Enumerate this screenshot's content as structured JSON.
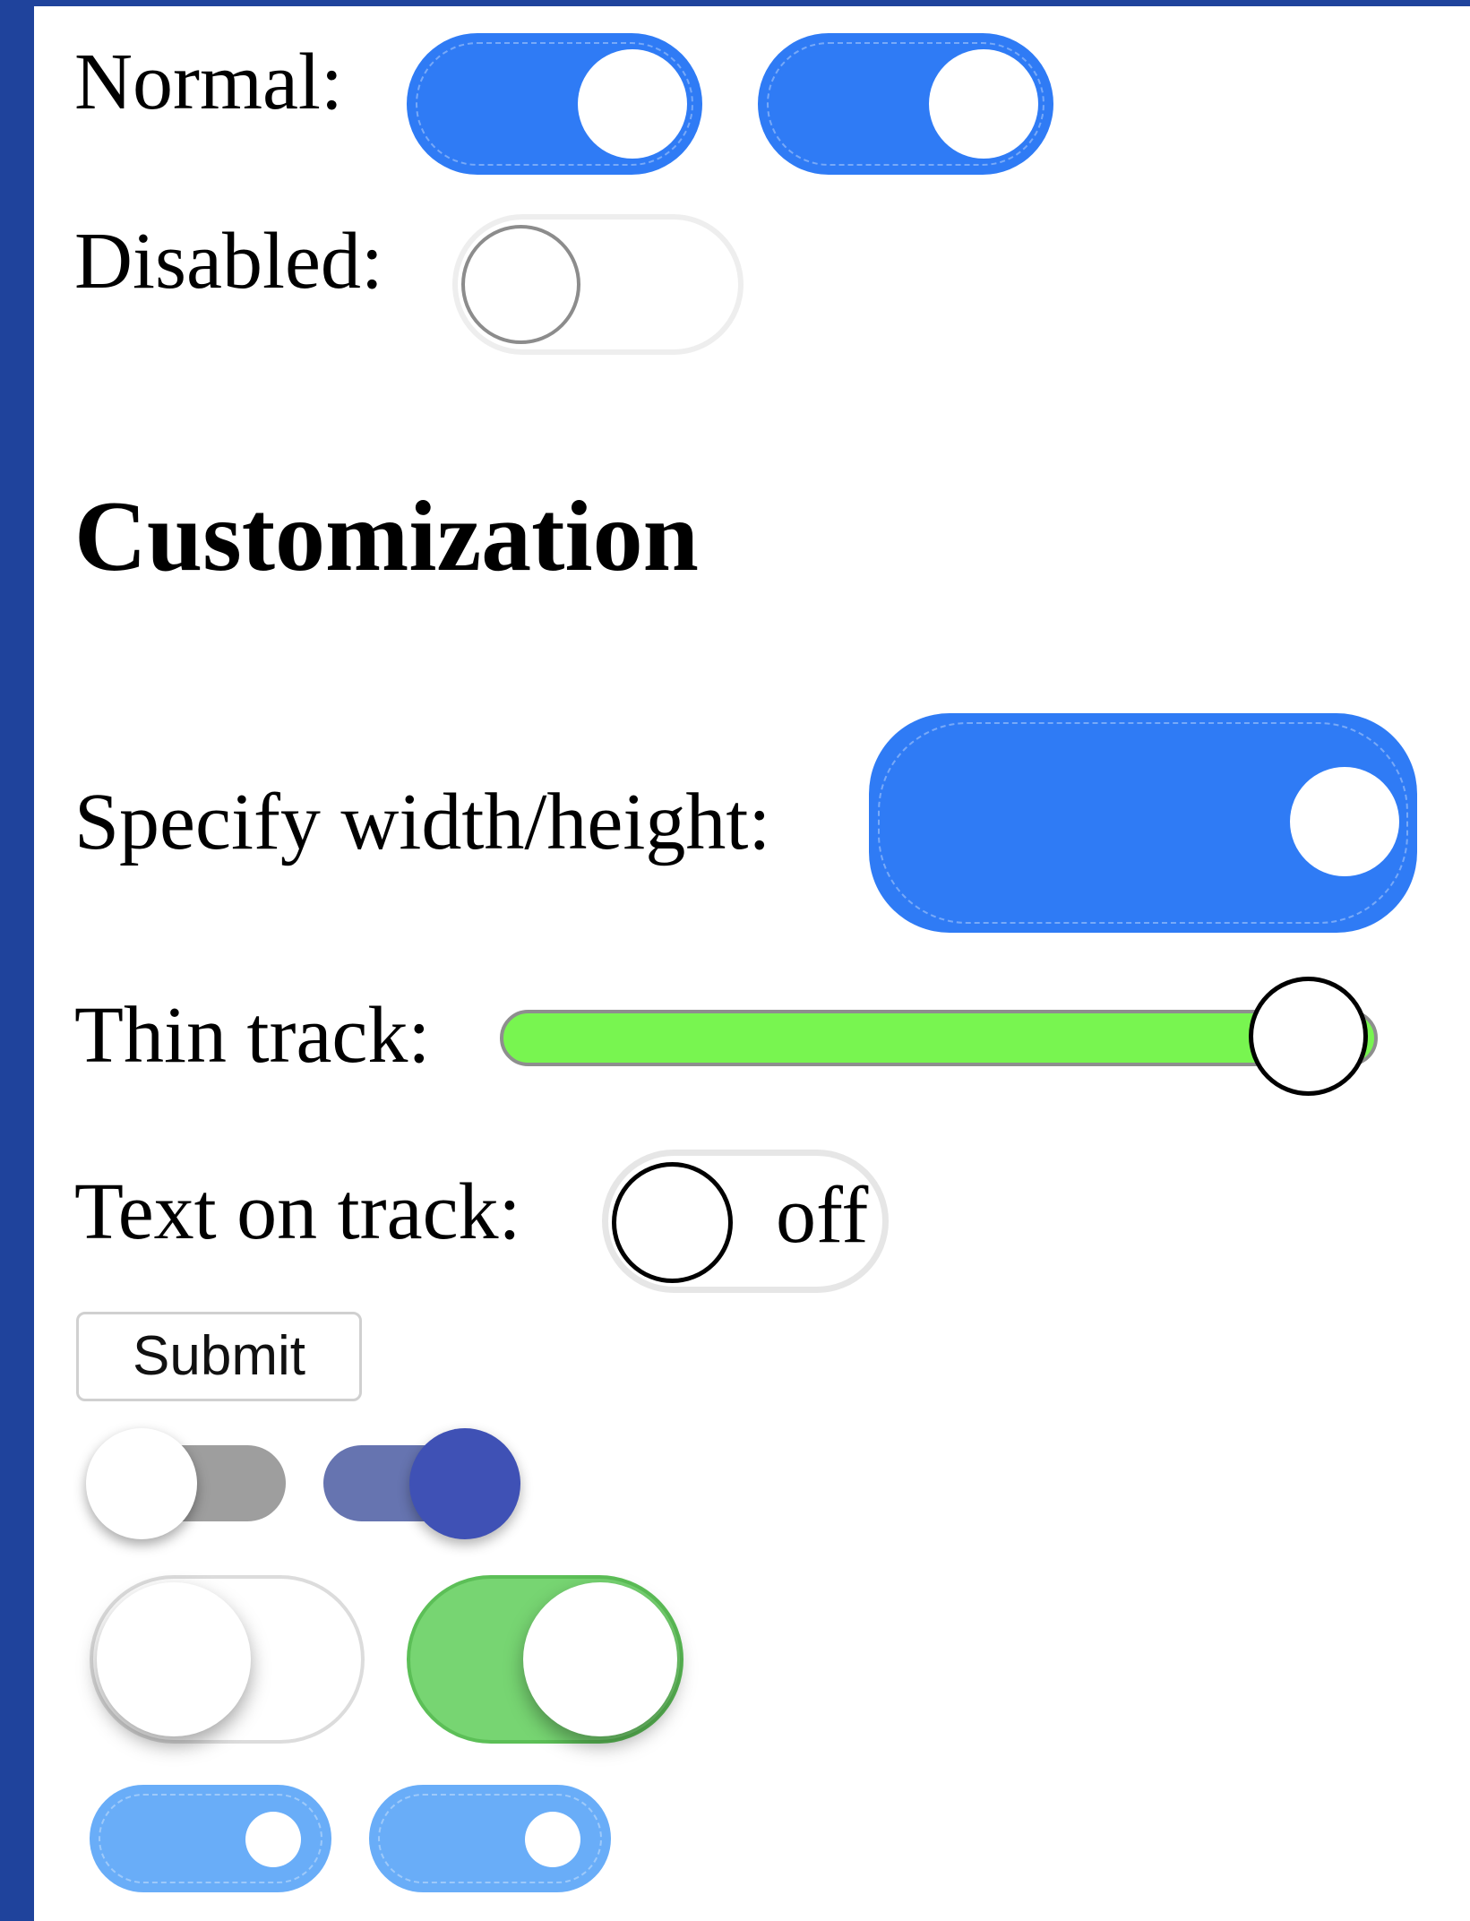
{
  "labels": {
    "normal": "Normal:",
    "disabled": "Disabled:",
    "customization": "Customization",
    "specify": "Specify width/height:",
    "thin_track": "Thin track:",
    "text_on_track": "Text on track:",
    "track_text_off": "off",
    "submit": "Submit"
  },
  "toggles": {
    "normal_1": {
      "state": "on"
    },
    "normal_2": {
      "state": "on"
    },
    "disabled": {
      "state": "off",
      "disabled": true
    },
    "specify_size": {
      "state": "on"
    },
    "thin_track": {
      "state": "on"
    },
    "text_on_track": {
      "state": "off"
    },
    "material_1": {
      "state": "off"
    },
    "material_2": {
      "state": "on"
    },
    "ios_1": {
      "state": "off"
    },
    "ios_2": {
      "state": "on"
    },
    "light_blue_1": {
      "state": "on"
    },
    "light_blue_2": {
      "state": "on"
    }
  },
  "colors": {
    "frame": "#1f439c",
    "primary_blue": "#2f7bf5",
    "thin_track_green": "#78f550",
    "material_indigo": "#3f51b5",
    "ios_green": "#77d572",
    "light_blue": "#69adf8"
  }
}
